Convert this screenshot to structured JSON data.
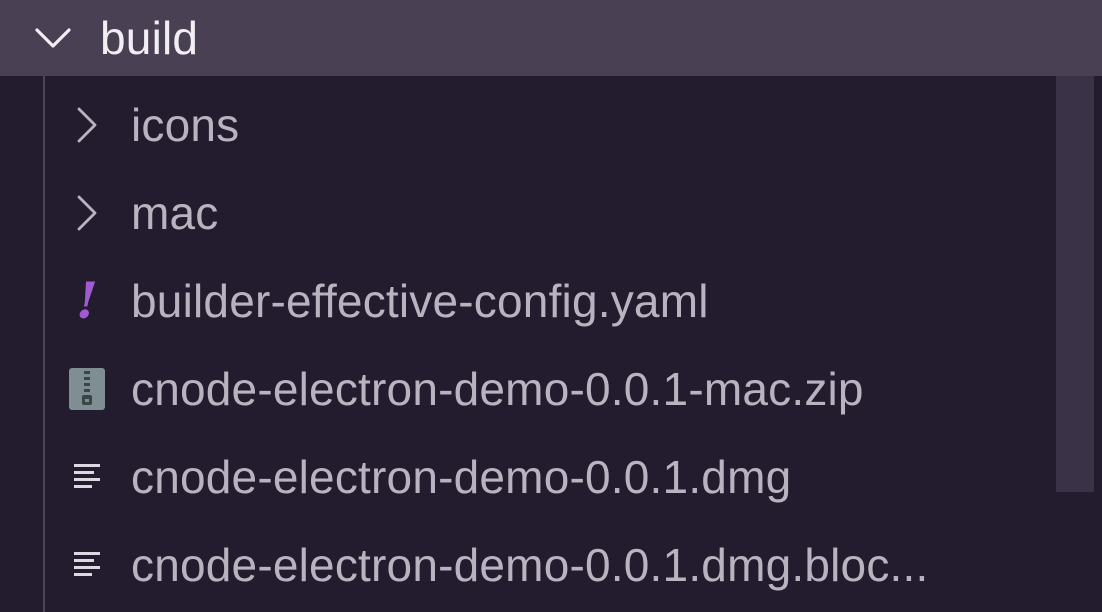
{
  "explorer": {
    "root": {
      "label": "build",
      "expanded": true,
      "icon": "chevron-down-icon"
    },
    "items": [
      {
        "label": "icons",
        "type": "folder",
        "icon": "chevron-right-icon"
      },
      {
        "label": "mac",
        "type": "folder",
        "icon": "chevron-right-icon"
      },
      {
        "label": "builder-effective-config.yaml",
        "type": "file",
        "icon": "yaml-exclamation-icon"
      },
      {
        "label": "cnode-electron-demo-0.0.1-mac.zip",
        "type": "file",
        "icon": "zip-archive-icon"
      },
      {
        "label": "cnode-electron-demo-0.0.1.dmg",
        "type": "file",
        "icon": "text-lines-icon"
      },
      {
        "label": "cnode-electron-demo-0.0.1.dmg.bloc...",
        "type": "file",
        "icon": "text-lines-icon"
      }
    ]
  },
  "colors": {
    "background": "#231b2e",
    "selected_row": "#4a4054",
    "text": "#b9b3c0",
    "selected_text": "#f1eef4",
    "yaml_accent": "#a15bd0",
    "zip_icon": "#7f8e92"
  }
}
